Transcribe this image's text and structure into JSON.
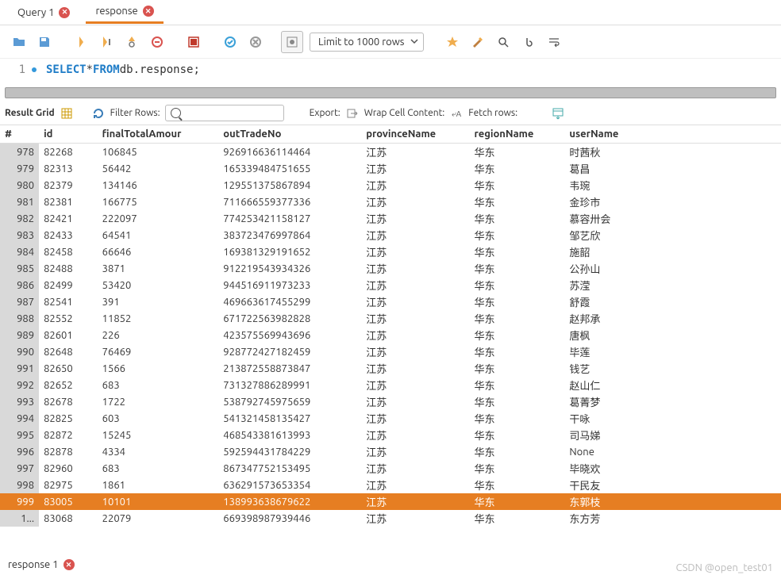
{
  "tabs": {
    "query": "Query 1",
    "response": "response"
  },
  "toolbar": {
    "limit": "Limit to 1000 rows"
  },
  "editor": {
    "lineno": "1",
    "kw1": "SELECT",
    "star": " * ",
    "kw2": "FROM",
    "rest": " db.response;"
  },
  "gridbar": {
    "resultGrid": "Result Grid",
    "filterRows": "Filter Rows:",
    "export": "Export:",
    "wrap": "Wrap Cell Content:",
    "fetch": "Fetch rows:"
  },
  "headers": {
    "row": "#",
    "id": "id",
    "amt": "finalTotalAmour",
    "out": "outTradeNo",
    "prov": "provinceName",
    "reg": "regionName",
    "user": "userName"
  },
  "chart_data": {
    "type": "table",
    "columns": [
      "#",
      "id",
      "finalTotalAmount",
      "outTradeNo",
      "provinceName",
      "regionName",
      "userName"
    ],
    "selected_row_index": 22,
    "rows": [
      {
        "row": "978",
        "id": "82268",
        "amt": "106845",
        "out": "926916636114464",
        "prov": "江苏",
        "reg": "华东",
        "user": "时茜秋"
      },
      {
        "row": "979",
        "id": "82313",
        "amt": "56442",
        "out": "165339484751655",
        "prov": "江苏",
        "reg": "华东",
        "user": "葛昌"
      },
      {
        "row": "980",
        "id": "82379",
        "amt": "134146",
        "out": "129551375867894",
        "prov": "江苏",
        "reg": "华东",
        "user": "韦琬"
      },
      {
        "row": "981",
        "id": "82381",
        "amt": "166775",
        "out": "711666559377336",
        "prov": "江苏",
        "reg": "华东",
        "user": "金珍市"
      },
      {
        "row": "982",
        "id": "82421",
        "amt": "222097",
        "out": "774253421158127",
        "prov": "江苏",
        "reg": "华东",
        "user": "慕容卅会"
      },
      {
        "row": "983",
        "id": "82433",
        "amt": "64541",
        "out": "383723476997864",
        "prov": "江苏",
        "reg": "华东",
        "user": "邹艺欣"
      },
      {
        "row": "984",
        "id": "82458",
        "amt": "66646",
        "out": "169381329191652",
        "prov": "江苏",
        "reg": "华东",
        "user": "施韶"
      },
      {
        "row": "985",
        "id": "82488",
        "amt": "3871",
        "out": "912219543934326",
        "prov": "江苏",
        "reg": "华东",
        "user": "公孙山"
      },
      {
        "row": "986",
        "id": "82499",
        "amt": "53420",
        "out": "944516911973233",
        "prov": "江苏",
        "reg": "华东",
        "user": "苏滢"
      },
      {
        "row": "987",
        "id": "82541",
        "amt": "391",
        "out": "469663617455299",
        "prov": "江苏",
        "reg": "华东",
        "user": "舒霞"
      },
      {
        "row": "988",
        "id": "82552",
        "amt": "11852",
        "out": "671722563982828",
        "prov": "江苏",
        "reg": "华东",
        "user": "赵邦承"
      },
      {
        "row": "989",
        "id": "82601",
        "amt": "226",
        "out": "423575569943696",
        "prov": "江苏",
        "reg": "华东",
        "user": "唐枫"
      },
      {
        "row": "990",
        "id": "82648",
        "amt": "76469",
        "out": "928772427182459",
        "prov": "江苏",
        "reg": "华东",
        "user": "毕莲"
      },
      {
        "row": "991",
        "id": "82650",
        "amt": "1566",
        "out": "213872558873847",
        "prov": "江苏",
        "reg": "华东",
        "user": "钱艺"
      },
      {
        "row": "992",
        "id": "82652",
        "amt": "683",
        "out": "731327886289991",
        "prov": "江苏",
        "reg": "华东",
        "user": "赵山仁"
      },
      {
        "row": "993",
        "id": "82678",
        "amt": "1722",
        "out": "538792745975659",
        "prov": "江苏",
        "reg": "华东",
        "user": "葛菁梦"
      },
      {
        "row": "994",
        "id": "82825",
        "amt": "603",
        "out": "541321458135427",
        "prov": "江苏",
        "reg": "华东",
        "user": "干咏"
      },
      {
        "row": "995",
        "id": "82872",
        "amt": "15245",
        "out": "468543381613993",
        "prov": "江苏",
        "reg": "华东",
        "user": "司马娣"
      },
      {
        "row": "996",
        "id": "82878",
        "amt": "4334",
        "out": "592594431784229",
        "prov": "江苏",
        "reg": "华东",
        "user": "None"
      },
      {
        "row": "997",
        "id": "82960",
        "amt": "683",
        "out": "867347752153495",
        "prov": "江苏",
        "reg": "华东",
        "user": "毕晓欢"
      },
      {
        "row": "998",
        "id": "82975",
        "amt": "1861",
        "out": "636291573653354",
        "prov": "江苏",
        "reg": "华东",
        "user": "干民友"
      },
      {
        "row": "999",
        "id": "83005",
        "amt": "10101",
        "out": "138993638679622",
        "prov": "江苏",
        "reg": "华东",
        "user": "东郭枝"
      },
      {
        "row": "1...",
        "id": "83068",
        "amt": "22079",
        "out": "669398987939446",
        "prov": "江苏",
        "reg": "华东",
        "user": "东方芳"
      }
    ]
  },
  "bottom": {
    "tab": "response 1"
  },
  "watermark": "CSDN @open_test01"
}
